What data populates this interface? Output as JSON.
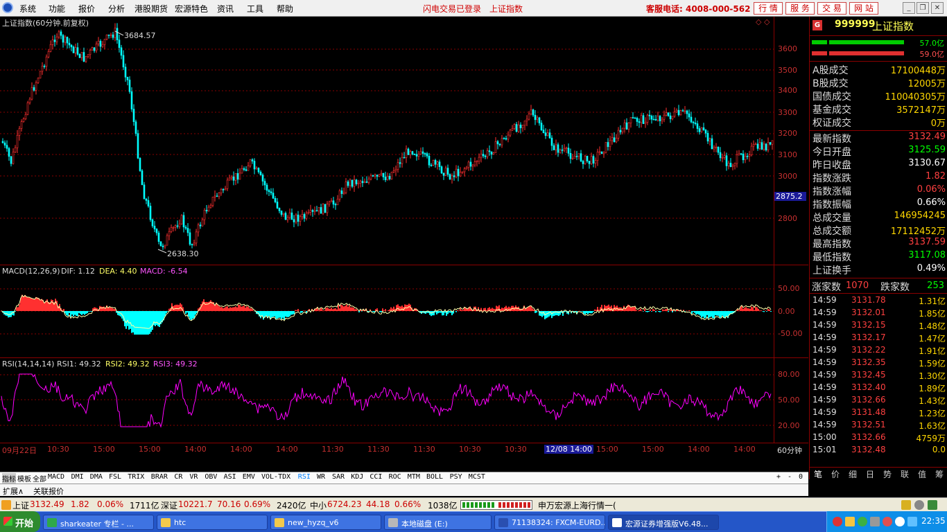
{
  "menu": {
    "items": [
      "系统",
      "功能",
      "报价",
      "分析",
      "港股期货",
      "宏源特色",
      "资讯",
      "工具",
      "帮助"
    ],
    "status_login": "闪电交易已登录",
    "status_index": "上证指数",
    "hotline": "客服电话: 4008-000-562",
    "nav_buttons": [
      "行 情",
      "服 务",
      "交 易",
      "网 站"
    ]
  },
  "chart": {
    "price_title": "上证指数(60分钟.前复权)",
    "high_label": "3684.57",
    "low_label": "2638.30",
    "cursor_value": "2875.2",
    "price_ticks": [
      "3600",
      "3500",
      "3400",
      "3300",
      "3200",
      "3100",
      "3000",
      "2800"
    ],
    "macd_title": "MACD(12,26,9)",
    "macd_dif": "DIF: 1.12",
    "macd_dea": "DEA: 4.40",
    "macd_val": "MACD: -6.54",
    "macd_ticks": [
      "50.00",
      "0.00",
      "-50.00"
    ],
    "rsi_title": "RSI(14,14,14)",
    "rsi1": "RSI1: 49.32",
    "rsi2": "RSI2: 49.32",
    "rsi3": "RSI3: 49.32",
    "rsi_ticks": [
      "80.00",
      "50.00",
      "20.00"
    ],
    "time_labels": [
      "09月22日",
      "10:30",
      "15:00",
      "15:00",
      "14:00",
      "14:00",
      "14:00",
      "11:30",
      "11:30",
      "11:30",
      "10:30",
      "10:30",
      "12/08 14:00",
      "15:00",
      "15:00",
      "14:00",
      "14:00"
    ],
    "period": "60分钟",
    "colors": {
      "up": "#ff3030",
      "down": "#00ffff",
      "dif": "#ffffaa",
      "rsi": "#ff00ff",
      "grid": "#8b0000",
      "label": "#c83030"
    }
  },
  "indicator_tabs": [
    "指标",
    "模板",
    "全部",
    "MACD",
    "DMI",
    "DMA",
    "FSL",
    "TRIX",
    "BRAR",
    "CR",
    "VR",
    "OBV",
    "ASI",
    "EMV",
    "VOL-TDX",
    "RSI",
    "WR",
    "SAR",
    "KDJ",
    "CCI",
    "ROC",
    "MTM",
    "BOLL",
    "PSY",
    "MCST"
  ],
  "indicator_active": "RSI",
  "zoom_buttons": [
    "+",
    "-",
    "0"
  ],
  "ext_tabs": [
    "扩展∧",
    "关联报价"
  ],
  "side": {
    "code": "999999",
    "name": "上证指数",
    "bar_top_value": "57.0亿",
    "bar_bottom_value": "59.0亿",
    "stats1": [
      {
        "label": "A股成交",
        "value": "17100448万",
        "color": "#ffd700"
      },
      {
        "label": "B股成交",
        "value": "12005万",
        "color": "#ffd700"
      },
      {
        "label": "国债成交",
        "value": "110040305万",
        "color": "#ffd700"
      },
      {
        "label": "基金成交",
        "value": "3572147万",
        "color": "#ffd700"
      },
      {
        "label": "权证成交",
        "value": "0万",
        "color": "#ffd700"
      }
    ],
    "stats2": [
      {
        "label": "最新指数",
        "value": "3132.49",
        "color": "#ff4040"
      },
      {
        "label": "今日开盘",
        "value": "3125.59",
        "color": "#00ff00"
      },
      {
        "label": "昨日收盘",
        "value": "3130.67",
        "color": "#ffffff"
      },
      {
        "label": "指数涨跌",
        "value": "1.82",
        "color": "#ff4040"
      },
      {
        "label": "指数涨幅",
        "value": "0.06%",
        "color": "#ff4040"
      },
      {
        "label": "指数振幅",
        "value": "0.66%",
        "color": "#ffffff"
      },
      {
        "label": "总成交量",
        "value": "146954245",
        "color": "#ffd700"
      },
      {
        "label": "总成交额",
        "value": "17112452万",
        "color": "#ffd700"
      },
      {
        "label": "最高指数",
        "value": "3137.59",
        "color": "#ff4040"
      },
      {
        "label": "最低指数",
        "value": "3117.08",
        "color": "#00ff00"
      },
      {
        "label": "上证换手",
        "value": "0.49%",
        "color": "#ffffff"
      }
    ],
    "up_label": "涨家数",
    "up_count": "1070",
    "down_label": "跌家数",
    "down_count": "253",
    "ticks": [
      {
        "t": "14:59",
        "p": "3131.78",
        "v": "1.31亿"
      },
      {
        "t": "14:59",
        "p": "3132.01",
        "v": "1.85亿"
      },
      {
        "t": "14:59",
        "p": "3132.15",
        "v": "1.48亿"
      },
      {
        "t": "14:59",
        "p": "3132.17",
        "v": "1.47亿"
      },
      {
        "t": "14:59",
        "p": "3132.22",
        "v": "1.91亿"
      },
      {
        "t": "14:59",
        "p": "3132.35",
        "v": "1.59亿"
      },
      {
        "t": "14:59",
        "p": "3132.45",
        "v": "1.30亿"
      },
      {
        "t": "14:59",
        "p": "3132.40",
        "v": "1.89亿"
      },
      {
        "t": "14:59",
        "p": "3132.66",
        "v": "1.43亿"
      },
      {
        "t": "14:59",
        "p": "3131.48",
        "v": "1.23亿"
      },
      {
        "t": "14:59",
        "p": "3132.51",
        "v": "1.63亿"
      },
      {
        "t": "15:00",
        "p": "3132.66",
        "v": "4759万"
      },
      {
        "t": "15:01",
        "p": "3132.48",
        "v": "0.0"
      }
    ],
    "tabs": [
      "笔",
      "价",
      "细",
      "日",
      "势",
      "联",
      "值",
      "筹"
    ]
  },
  "status": {
    "sh_label": "上证",
    "sh_price": "3132.49",
    "sh_chg": "1.82",
    "sh_pct": "0.06%",
    "sh_amt": "1711亿",
    "sz_label": "深证",
    "sz_price": "10221.7",
    "sz_chg": "70.16",
    "sz_pct": "0.69%",
    "sz_amt": "2420亿",
    "zx_label": "中小",
    "zx_price": "6724.23",
    "zx_chg": "44.18",
    "zx_pct": "0.66%",
    "zx_amt": "1038亿",
    "news": "申万宏源上海行情一("
  },
  "taskbar": {
    "start": "开始",
    "items": [
      "sharkeater 专栏 - ...",
      "htc",
      "new_hyzq_v6",
      "本地磁盘 (E:)",
      "71138324: FXCM-EURD...",
      "宏源证券增强版V6.48..."
    ],
    "clock": "22:35"
  }
}
